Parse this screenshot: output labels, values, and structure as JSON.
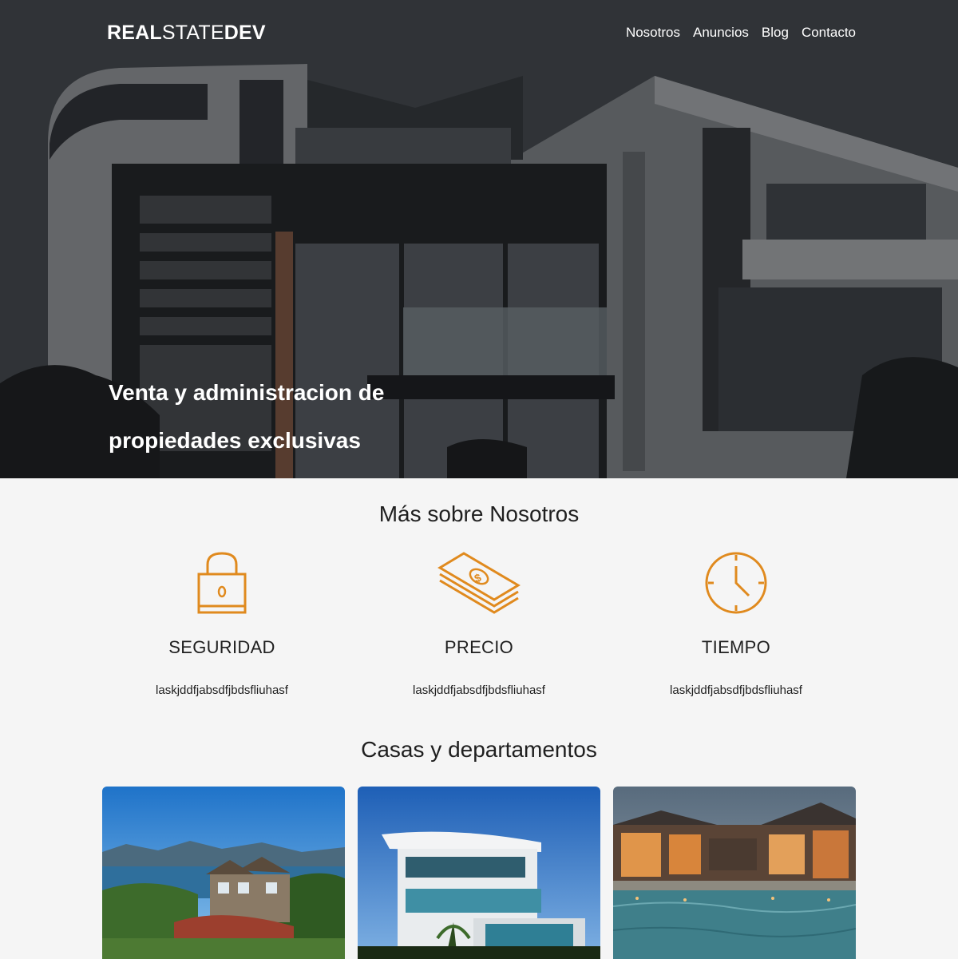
{
  "header": {
    "logo_bold": "REAL",
    "logo_light": "STATE",
    "logo_bold2": "DEV",
    "nav": [
      "Nosotros",
      "Anuncios",
      "Blog",
      "Contacto"
    ]
  },
  "hero": {
    "title": "Venta y administracion de propiedades exclusivas"
  },
  "about": {
    "title": "Más sobre Nosotros",
    "features": [
      {
        "icon": "lock-icon",
        "title": "SEGURIDAD",
        "text": "laskjddfjabsdfjbdsfliuhasf"
      },
      {
        "icon": "money-icon",
        "title": "PRECIO",
        "text": "laskjddfjabsdfjbdsfliuhasf"
      },
      {
        "icon": "clock-icon",
        "title": "TIEMPO",
        "text": "laskjddfjabsdfjbdsfliuhasf"
      }
    ]
  },
  "listings": {
    "title": "Casas y departamentos"
  },
  "colors": {
    "accent": "#e08a1e",
    "background": "#f5f5f5",
    "text": "#1f1f1f"
  }
}
